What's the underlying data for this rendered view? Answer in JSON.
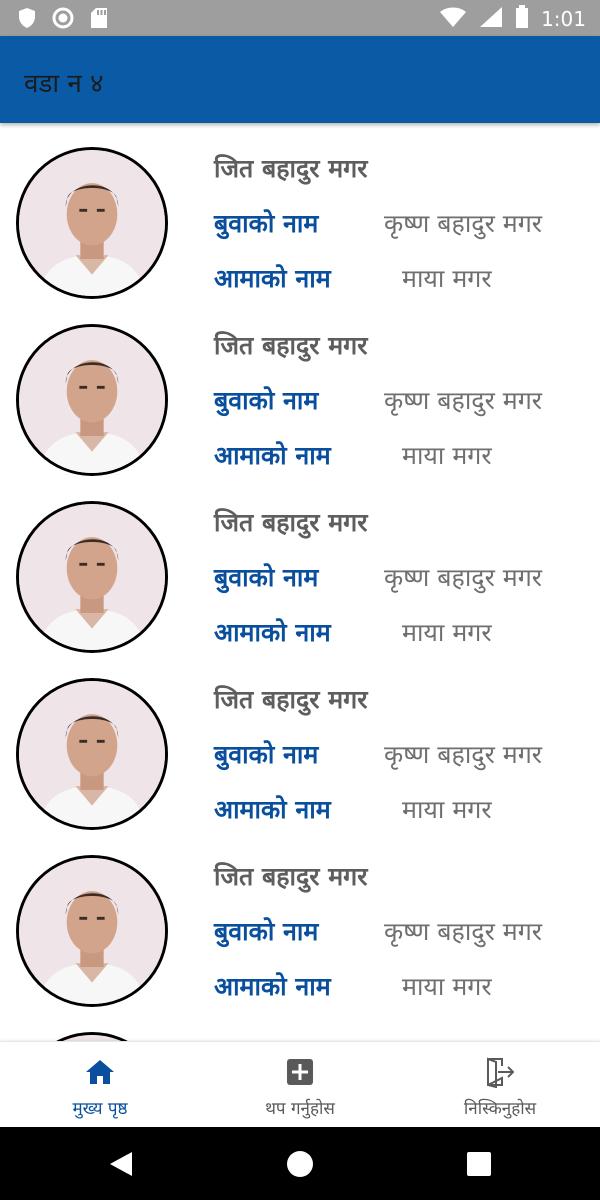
{
  "status_bar": {
    "time": "1:01",
    "left_icons": [
      "shield-icon",
      "circle-icon",
      "sd-card-icon"
    ],
    "right_icons": [
      "wifi-icon",
      "signal-icon",
      "battery-icon"
    ]
  },
  "app_bar": {
    "title": "वडा न ४"
  },
  "colors": {
    "primary": "#0a5aa6",
    "label_blue": "#0a4f9e",
    "status_bar": "#9e9e9e"
  },
  "list": {
    "items": [
      {
        "name": "जित बहादुर मगर",
        "father_label": "बुवाको नाम",
        "father_value": "कृष्ण बहादुर मगर",
        "mother_label": "आमाको नाम",
        "mother_value": "माया मगर"
      },
      {
        "name": "जित बहादुर मगर",
        "father_label": "बुवाको नाम",
        "father_value": "कृष्ण बहादुर मगर",
        "mother_label": "आमाको नाम",
        "mother_value": "माया मगर"
      },
      {
        "name": "जित बहादुर मगर",
        "father_label": "बुवाको नाम",
        "father_value": "कृष्ण बहादुर मगर",
        "mother_label": "आमाको नाम",
        "mother_value": "माया मगर"
      },
      {
        "name": "जित बहादुर मगर",
        "father_label": "बुवाको नाम",
        "father_value": "कृष्ण बहादुर मगर",
        "mother_label": "आमाको नाम",
        "mother_value": "माया मगर"
      },
      {
        "name": "जित बहादुर मगर",
        "father_label": "बुवाको नाम",
        "father_value": "कृष्ण बहादुर मगर",
        "mother_label": "आमाको नाम",
        "mother_value": "माया मगर"
      }
    ]
  },
  "bottom_nav": {
    "items": [
      {
        "label": "मुख्य पृष्ठ",
        "icon": "home-icon",
        "active": true
      },
      {
        "label": "थप गर्नुहोस",
        "icon": "add-box-icon",
        "active": false
      },
      {
        "label": "निस्किनुहोस",
        "icon": "logout-icon",
        "active": false
      }
    ]
  },
  "system_nav": {
    "icons": [
      "back-icon",
      "home-circle-icon",
      "recents-icon"
    ]
  }
}
